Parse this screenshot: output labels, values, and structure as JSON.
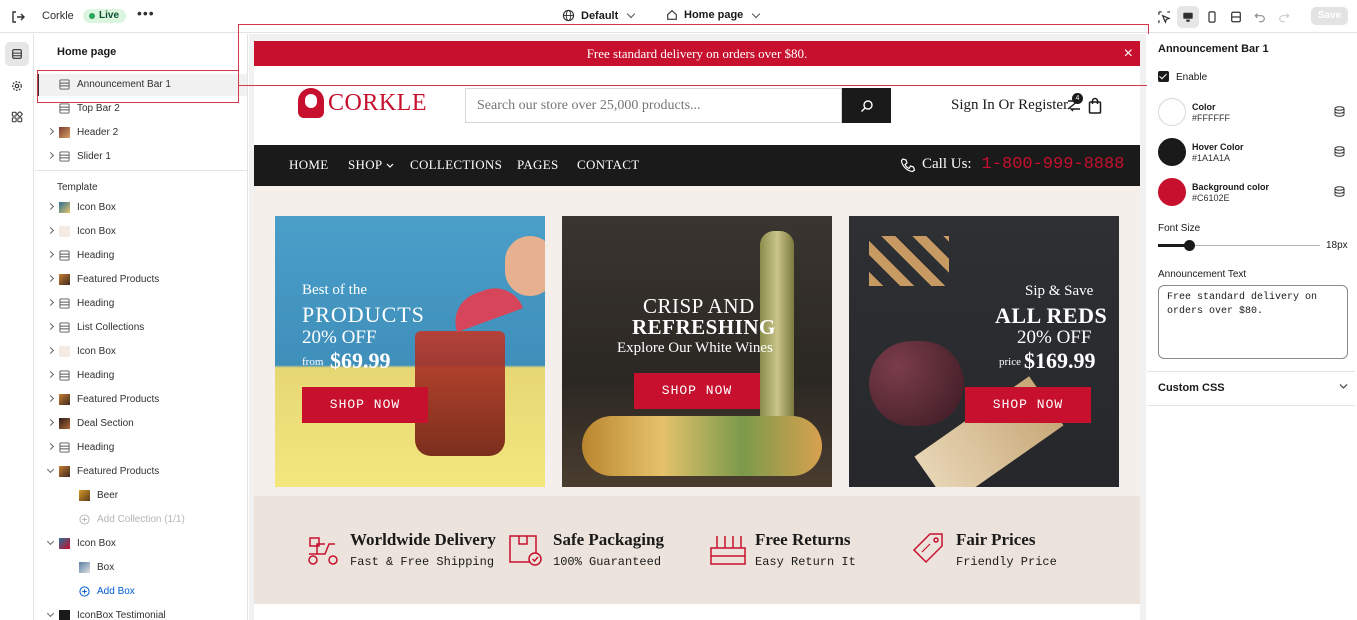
{
  "topbar": {
    "store_name": "Corkle",
    "status": "Live",
    "theme": "Default",
    "page": "Home page",
    "save_label": "Save"
  },
  "left_panel": {
    "title": "Home page",
    "header_sections": [
      {
        "label": "Announcement Bar 1",
        "selected": true
      },
      {
        "label": "Top Bar 2"
      },
      {
        "label": "Header 2"
      },
      {
        "label": "Slider 1"
      }
    ],
    "template_label": "Template",
    "template_sections": [
      {
        "label": "Icon Box"
      },
      {
        "label": "Icon Box"
      },
      {
        "label": "Heading"
      },
      {
        "label": "Featured Products"
      },
      {
        "label": "Heading"
      },
      {
        "label": "List Collections"
      },
      {
        "label": "Icon Box"
      },
      {
        "label": "Heading"
      },
      {
        "label": "Featured Products"
      },
      {
        "label": "Deal Section"
      },
      {
        "label": "Heading"
      },
      {
        "label": "Featured Products"
      }
    ],
    "featured_children": [
      "Beer"
    ],
    "add_collection": "Add Collection (1/1)",
    "icon_box": "Icon Box",
    "icon_box_children": [
      "Box"
    ],
    "add_box": "Add Box",
    "last_section": "IconBox Testimonial"
  },
  "preview": {
    "announcement": "Free standard delivery on orders over $80.",
    "logo": "CORKLE",
    "search_placeholder": "Search our store over 25,000 products...",
    "account": "Sign In Or Register",
    "compare_count": "4",
    "nav": [
      "HOME",
      "SHOP",
      "COLLECTIONS",
      "PAGES",
      "CONTACT"
    ],
    "call_label": "Call Us:",
    "call_number": "1-800-999-8888",
    "banners": [
      {
        "l1": "Best of the",
        "l2": "PRODUCTS",
        "l3": "20% OFF",
        "l4a": "from",
        "l4b": "$69.99",
        "button": "SHOP NOW"
      },
      {
        "l1": "CRISP AND",
        "l2": "REFRESHING",
        "l3": "Explore Our White Wines",
        "button": "SHOP NOW"
      },
      {
        "l1": "Sip & Save",
        "l2": "ALL REDS",
        "l3": "20% OFF",
        "l4a": "price",
        "l4b": "$169.99",
        "button": "SHOP NOW"
      }
    ],
    "features": [
      {
        "title": "Worldwide Delivery",
        "sub": "Fast & Free Shipping"
      },
      {
        "title": "Safe Packaging",
        "sub": "100% Guaranteed"
      },
      {
        "title": "Free Returns",
        "sub": "Easy Return It"
      },
      {
        "title": "Fair Prices",
        "sub": "Friendly Price"
      }
    ]
  },
  "settings": {
    "title": "Announcement Bar 1",
    "enable_label": "Enable",
    "colors": [
      {
        "name": "Color",
        "hex": "#FFFFFF"
      },
      {
        "name": "Hover Color",
        "hex": "#1A1A1A"
      },
      {
        "name": "Background color",
        "hex": "#C6102E"
      }
    ],
    "font_size_label": "Font Size",
    "font_size_value": "18px",
    "font_size_fraction": 0.19,
    "announcement_label": "Announcement Text",
    "announcement_text": "Free standard delivery on orders over $80.",
    "custom_css_label": "Custom CSS"
  },
  "colors": {
    "accent": "#C6102E",
    "dark": "#1A1A1A",
    "selection": "#D6384B"
  }
}
